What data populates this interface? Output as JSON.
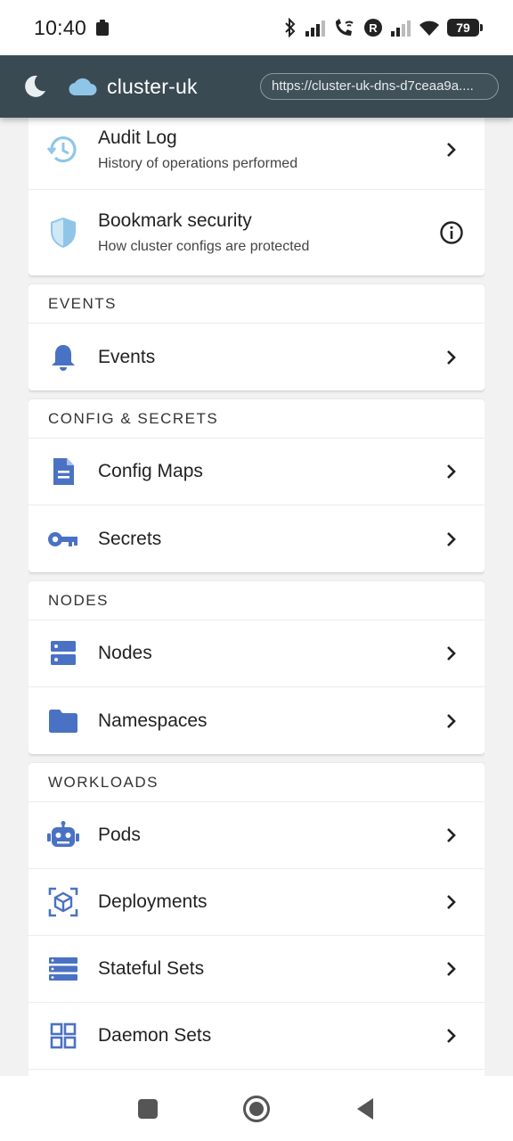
{
  "status_bar": {
    "time": "10:40",
    "battery": "79"
  },
  "app_bar": {
    "title": "cluster-uk",
    "url": "https://cluster-uk-dns-d7ceaa9a...."
  },
  "security_card": {
    "items": [
      {
        "title": "Audit Log",
        "subtitle": "History of operations performed",
        "icon": "history-icon",
        "action": "chevron-right-icon"
      },
      {
        "title": "Bookmark security",
        "subtitle": "How cluster configs are protected",
        "icon": "shield-icon",
        "action": "info-icon"
      }
    ]
  },
  "sections": [
    {
      "header": "EVENTS",
      "items": [
        {
          "label": "Events",
          "icon": "bell-icon"
        }
      ]
    },
    {
      "header": "CONFIG & SECRETS",
      "items": [
        {
          "label": "Config Maps",
          "icon": "document-icon"
        },
        {
          "label": "Secrets",
          "icon": "key-icon"
        }
      ]
    },
    {
      "header": "NODES",
      "items": [
        {
          "label": "Nodes",
          "icon": "server-icon"
        },
        {
          "label": "Namespaces",
          "icon": "folder-icon"
        }
      ]
    },
    {
      "header": "WORKLOADS",
      "items": [
        {
          "label": "Pods",
          "icon": "robot-icon"
        },
        {
          "label": "Deployments",
          "icon": "cube-icon"
        },
        {
          "label": "Stateful Sets",
          "icon": "stack-icon"
        },
        {
          "label": "Daemon Sets",
          "icon": "grid-icon"
        }
      ]
    }
  ],
  "colors": {
    "app_bar": "#3a4a53",
    "icon_blue": "#4a72c4",
    "icon_light": "#8fc6e8"
  }
}
